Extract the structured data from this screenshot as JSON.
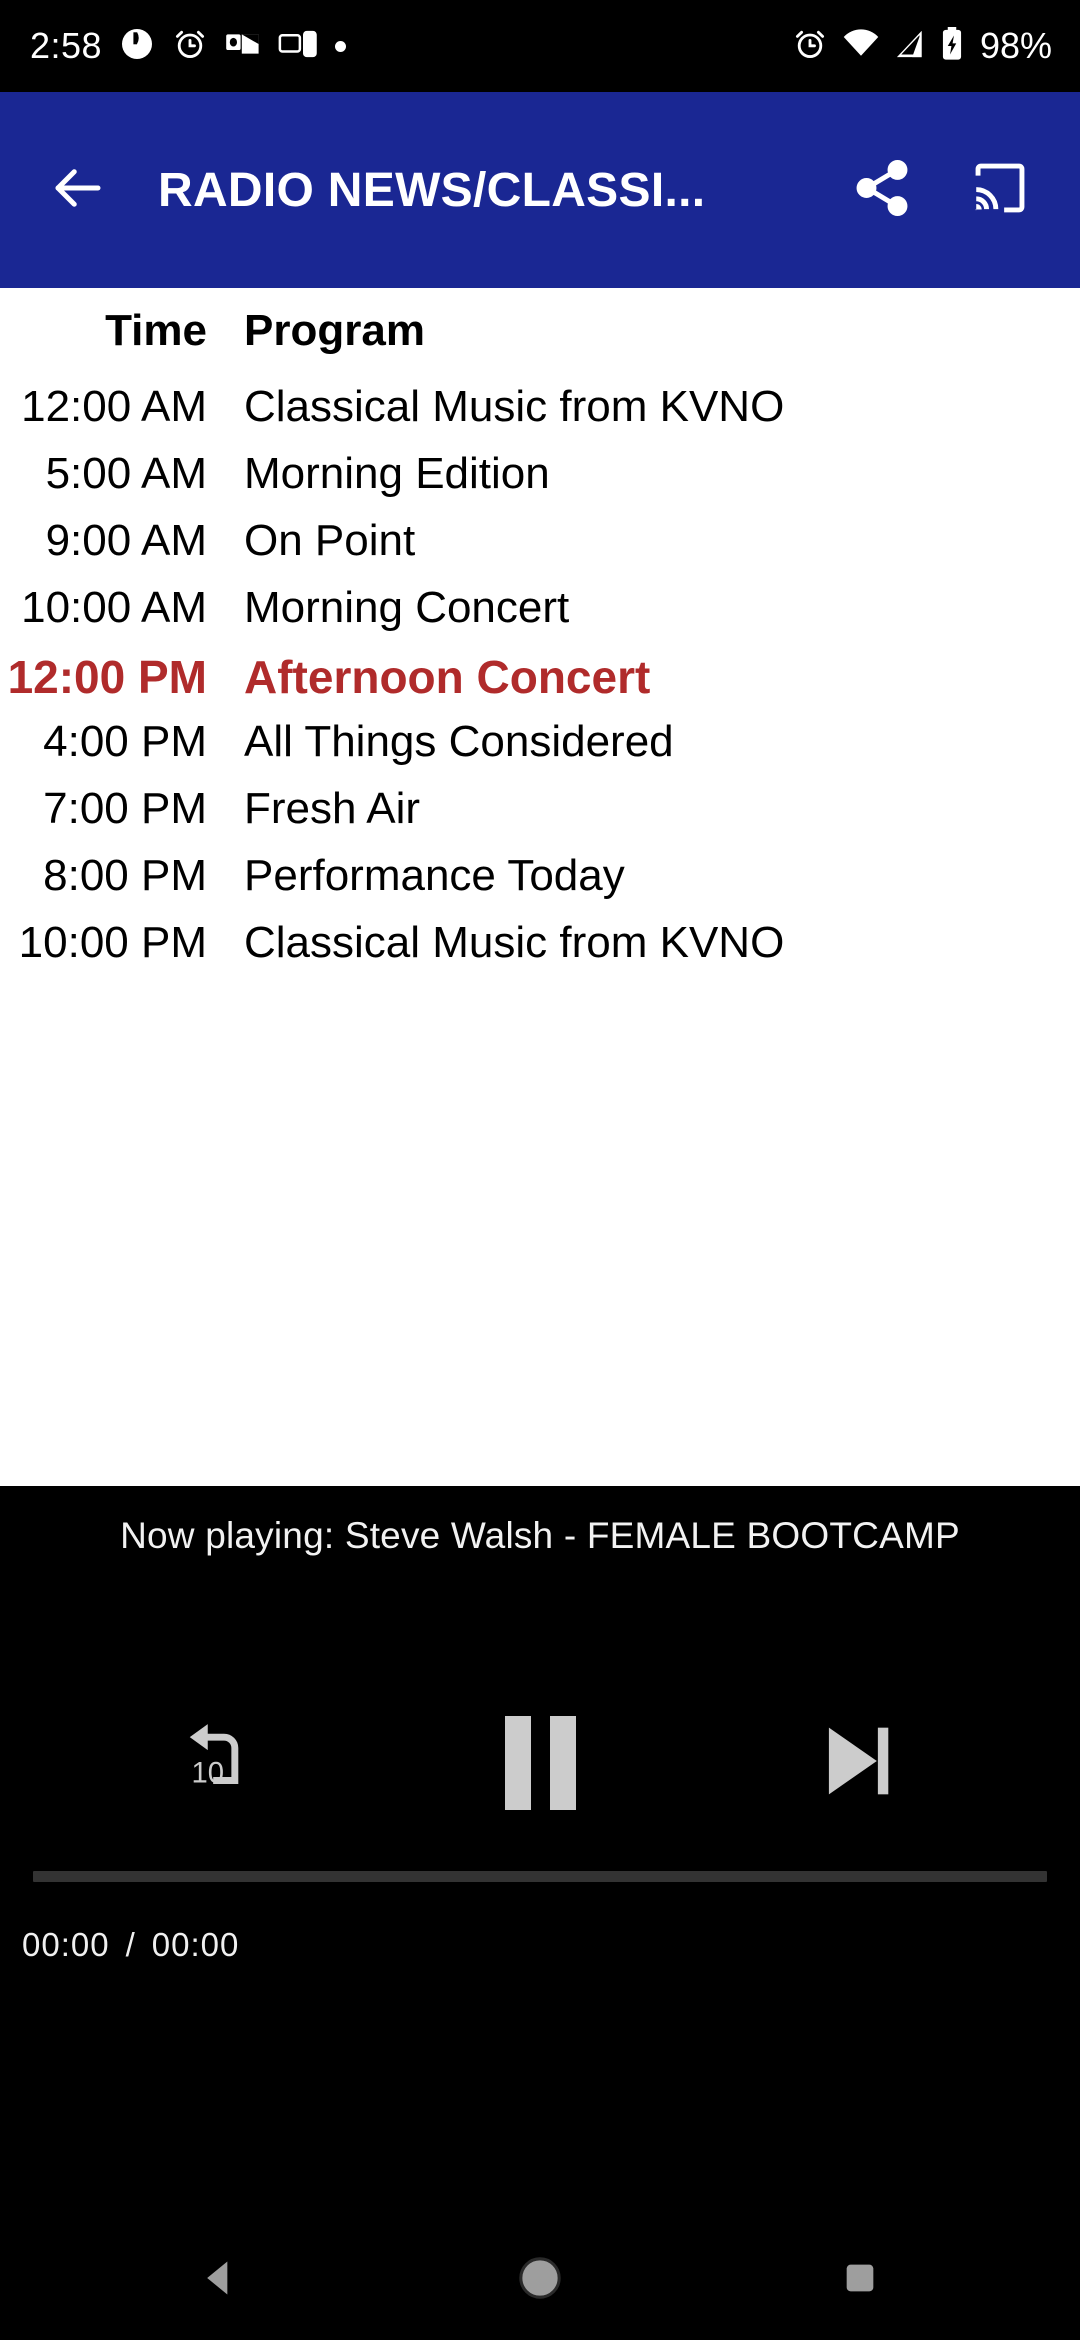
{
  "status_bar": {
    "clock": "2:58",
    "battery_percent": "98%",
    "left_icons": [
      "pie-timer-icon",
      "alarm-clock-icon",
      "outlook-mail-icon",
      "cast-device-icon",
      "more-dot-icon"
    ],
    "right_icons": [
      "alarm-clock-icon",
      "wifi-icon",
      "signal-icon",
      "battery-charging-icon"
    ]
  },
  "app_bar": {
    "title": "RADIO NEWS/CLASSI...",
    "back_icon": "back-arrow-icon",
    "share_icon": "share-icon",
    "cast_icon": "cast-icon",
    "background_color": "#1a2793"
  },
  "schedule": {
    "headers": {
      "time": "Time",
      "program": "Program"
    },
    "current_color": "#b02b2b",
    "rows": [
      {
        "time": "12:00 AM",
        "program": "Classical Music from KVNO",
        "current": false
      },
      {
        "time": "5:00 AM",
        "program": "Morning Edition",
        "current": false
      },
      {
        "time": "9:00 AM",
        "program": "On Point",
        "current": false
      },
      {
        "time": "10:00 AM",
        "program": "Morning Concert",
        "current": false
      },
      {
        "time": "12:00 PM",
        "program": "Afternoon Concert",
        "current": true
      },
      {
        "time": "4:00 PM",
        "program": "All Things Considered",
        "current": false
      },
      {
        "time": "7:00 PM",
        "program": "Fresh Air",
        "current": false
      },
      {
        "time": "8:00 PM",
        "program": "Performance Today",
        "current": false
      },
      {
        "time": "10:00 PM",
        "program": "Classical Music from KVNO",
        "current": false
      }
    ]
  },
  "player": {
    "now_playing": "Now playing: Steve Walsh - FEMALE BOOTCAMP",
    "rewind_label": "10",
    "rewind_icon": "replay-10-icon",
    "play_pause_icon": "pause-icon",
    "next_icon": "skip-next-icon",
    "elapsed_time": "00:00",
    "time_separator": "/",
    "total_time": "00:00",
    "progress_percent": 0
  },
  "nav_bar": {
    "back_icon": "nav-back-triangle-icon",
    "home_icon": "nav-home-circle-icon",
    "recents_icon": "nav-recents-square-icon"
  }
}
